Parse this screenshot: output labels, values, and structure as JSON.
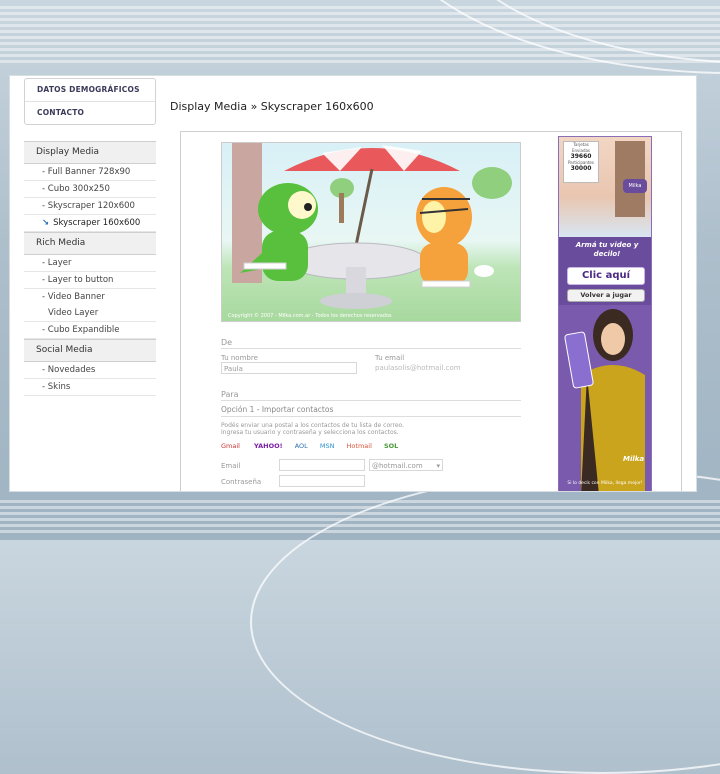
{
  "sidebar": {
    "top_items": [
      "DATOS DEMOGRÁFICOS",
      "CONTACTO"
    ],
    "sections": [
      {
        "title": "Display Media",
        "items": [
          {
            "label": "- Full Banner 728x90"
          },
          {
            "label": "- Cubo 300x250"
          },
          {
            "label": "- Skyscraper 120x600"
          },
          {
            "label": "Skyscraper 160x600",
            "active": true
          }
        ]
      },
      {
        "title": "Rich Media",
        "items": [
          {
            "label": "- Layer"
          },
          {
            "label": "- Layer to button"
          },
          {
            "label": "- Video Banner"
          },
          {
            "label": "Video Layer",
            "sub": true
          },
          {
            "label": "- Cubo Expandible"
          }
        ]
      },
      {
        "title": "Social Media",
        "items": [
          {
            "label": "- Novedades"
          },
          {
            "label": "- Skins"
          }
        ]
      }
    ]
  },
  "main": {
    "title": "Display Media » Skyscraper 160x600"
  },
  "form": {
    "de_label": "De",
    "tu_nombre_label": "Tu nombre",
    "tu_nombre_value": "Paula",
    "tu_email_label": "Tu email",
    "tu_email_value": "paulasolis@hotmail.com",
    "para_label": "Para",
    "opcion_label": "Opción 1 - Importar contactos",
    "instructions_1": "Podés enviar una postal a los contactos de tu lista de correo.",
    "instructions_2": "Ingresa tu usuario y contraseña y selecciona los contactos.",
    "providers": [
      "Gmail",
      "YAHOO!",
      "AOL",
      "MSN",
      "Hotmail",
      "SOL"
    ],
    "email_label": "Email",
    "email_domain": "@hotmail.com",
    "password_label": "Contraseña",
    "card_caption": "Copyright © 2007 - Milka.com.ar - Todos los derechos reservados"
  },
  "ad": {
    "counter_label_1": "Tarjetas Enviadas",
    "counter_value_1": "39660",
    "counter_label_2": "Participantes",
    "counter_value_2": "30000",
    "tagline": "Armá tu video y decilo!",
    "cta_primary": "Clic aquí",
    "cta_secondary": "Volver a jugar",
    "footer": "Si lo decís con Milka, llega mejor!",
    "brand": "Milka"
  },
  "colors": {
    "ad_purple": "#6a4c9c",
    "accent_blue": "#2a6fb0"
  }
}
